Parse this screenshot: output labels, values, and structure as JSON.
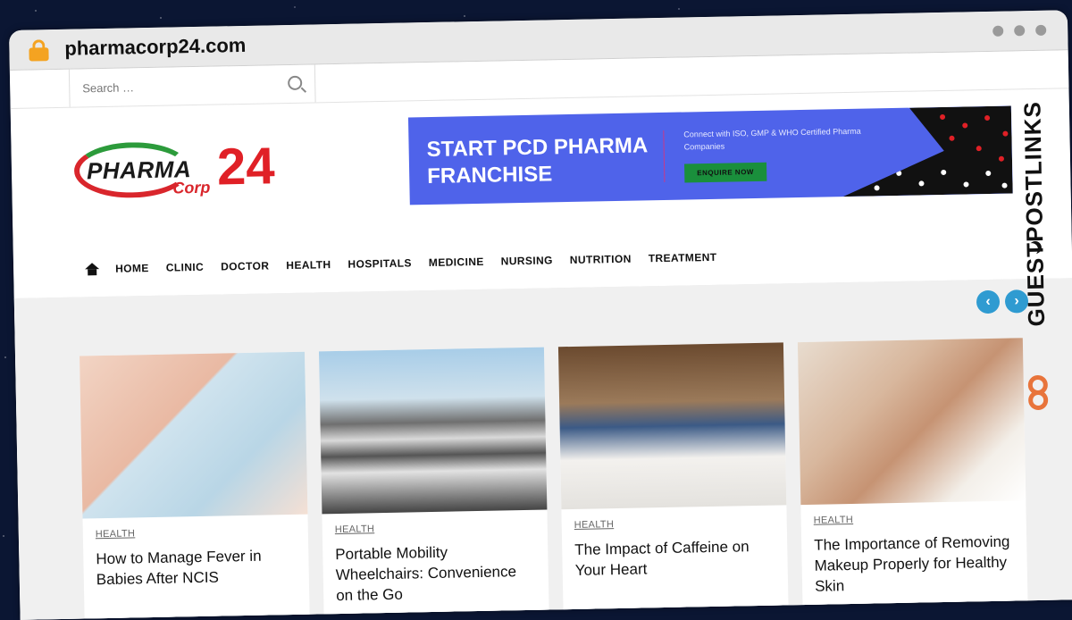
{
  "browser": {
    "url": "pharmacorp24.com"
  },
  "search": {
    "placeholder": "Search …"
  },
  "logo": {
    "pharma": "PHARMA",
    "corp": "Corp",
    "number": "24"
  },
  "banner": {
    "headline": "START PCD PHARMA FRANCHISE",
    "subtext": "Connect with ISO, GMP & WHO Certified Pharma Companies",
    "button": "ENQUIRE NOW"
  },
  "nav": {
    "items": [
      "HOME",
      "CLINIC",
      "DOCTOR",
      "HEALTH",
      "HOSPITALS",
      "MEDICINE",
      "NURSING",
      "NUTRITION",
      "TREATMENT"
    ]
  },
  "slider": {
    "prev": "‹",
    "next": "›"
  },
  "cards": [
    {
      "category": "HEALTH",
      "title": "How to Manage Fever in Babies After NCIS"
    },
    {
      "category": "HEALTH",
      "title": "Portable Mobility Wheelchairs: Convenience on the Go"
    },
    {
      "category": "HEALTH",
      "title": "The Impact of Caffeine on Your Heart"
    },
    {
      "category": "HEALTH",
      "title": "The Importance of Removing Makeup Properly for Healthy Skin"
    }
  ],
  "watermark": {
    "text": "GUESTPOSTLINKS"
  },
  "colors": {
    "accent": "#2f9bd1",
    "banner": "#4f63ea",
    "brand_red": "#e02026"
  }
}
